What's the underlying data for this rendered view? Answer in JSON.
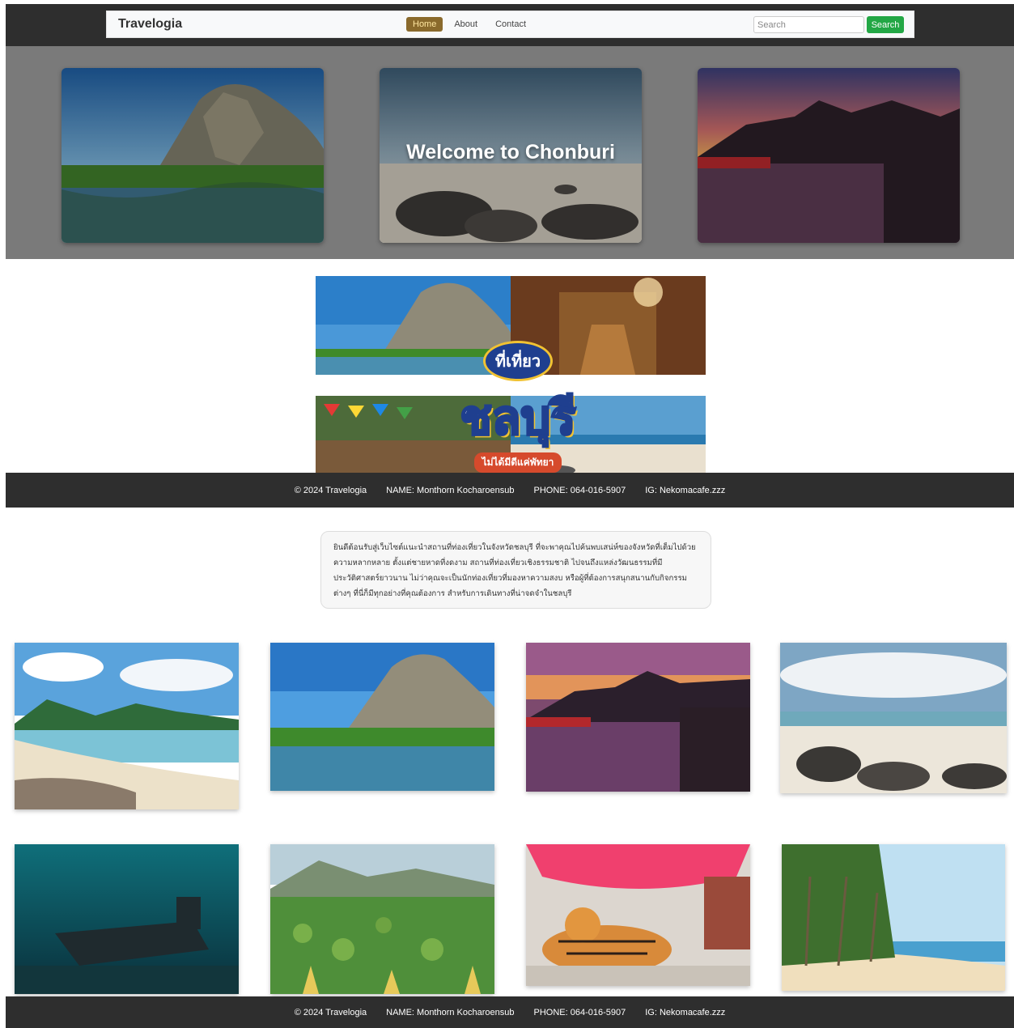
{
  "navbar": {
    "brand": "Travelogia",
    "links": [
      {
        "label": "Home",
        "active": true
      },
      {
        "label": "About",
        "active": false
      },
      {
        "label": "Contact",
        "active": false
      }
    ],
    "search_placeholder": "Search",
    "search_button": "Search"
  },
  "hero": {
    "title": "Welcome to Chonburi"
  },
  "banner": {
    "small_text": "ที่เที่ยว",
    "big_text": "ชลบุรี",
    "tag_text": "ไม่ได้มีดีแค่พัทยา"
  },
  "footer": {
    "copyright": "© 2024 Travelogia",
    "name": "NAME: Monthorn Kocharoensub",
    "phone": "PHONE: 064-016-5907",
    "ig": "IG: Nekomacafe.zzz"
  },
  "intro": {
    "text": "ยินดีต้อนรับสู่เว็บไซต์แนะนำสถานที่ท่องเที่ยวในจังหวัดชลบุรี   ที่จะพาคุณไปค้นพบเสน่ห์ของจังหวัดที่เต็มไปด้วยความหลากหลาย ตั้งแต่ชายหาดที่งดงาม สถานที่ท่องเที่ยวเชิงธรรมชาติ ไปจนถึงแหล่งวัฒนธรรมที่มีประวัติศาสตร์ยาวนาน   ไม่ว่าคุณจะเป็นนักท่องเที่ยวที่มองหาความสงบ   หรือผู้ที่ต้องการสนุกสนานกับกิจกรรมต่างๆ ที่นี่ก็มีทุกอย่างที่คุณต้องการ สำหรับการเดินทางที่น่าจดจำในชลบุรี"
  },
  "colors": {
    "dark_band": "#2e2e2e",
    "hero_bg": "#7a7a7a",
    "search_button": "#23a745",
    "active_link": "#8a6a2c"
  }
}
